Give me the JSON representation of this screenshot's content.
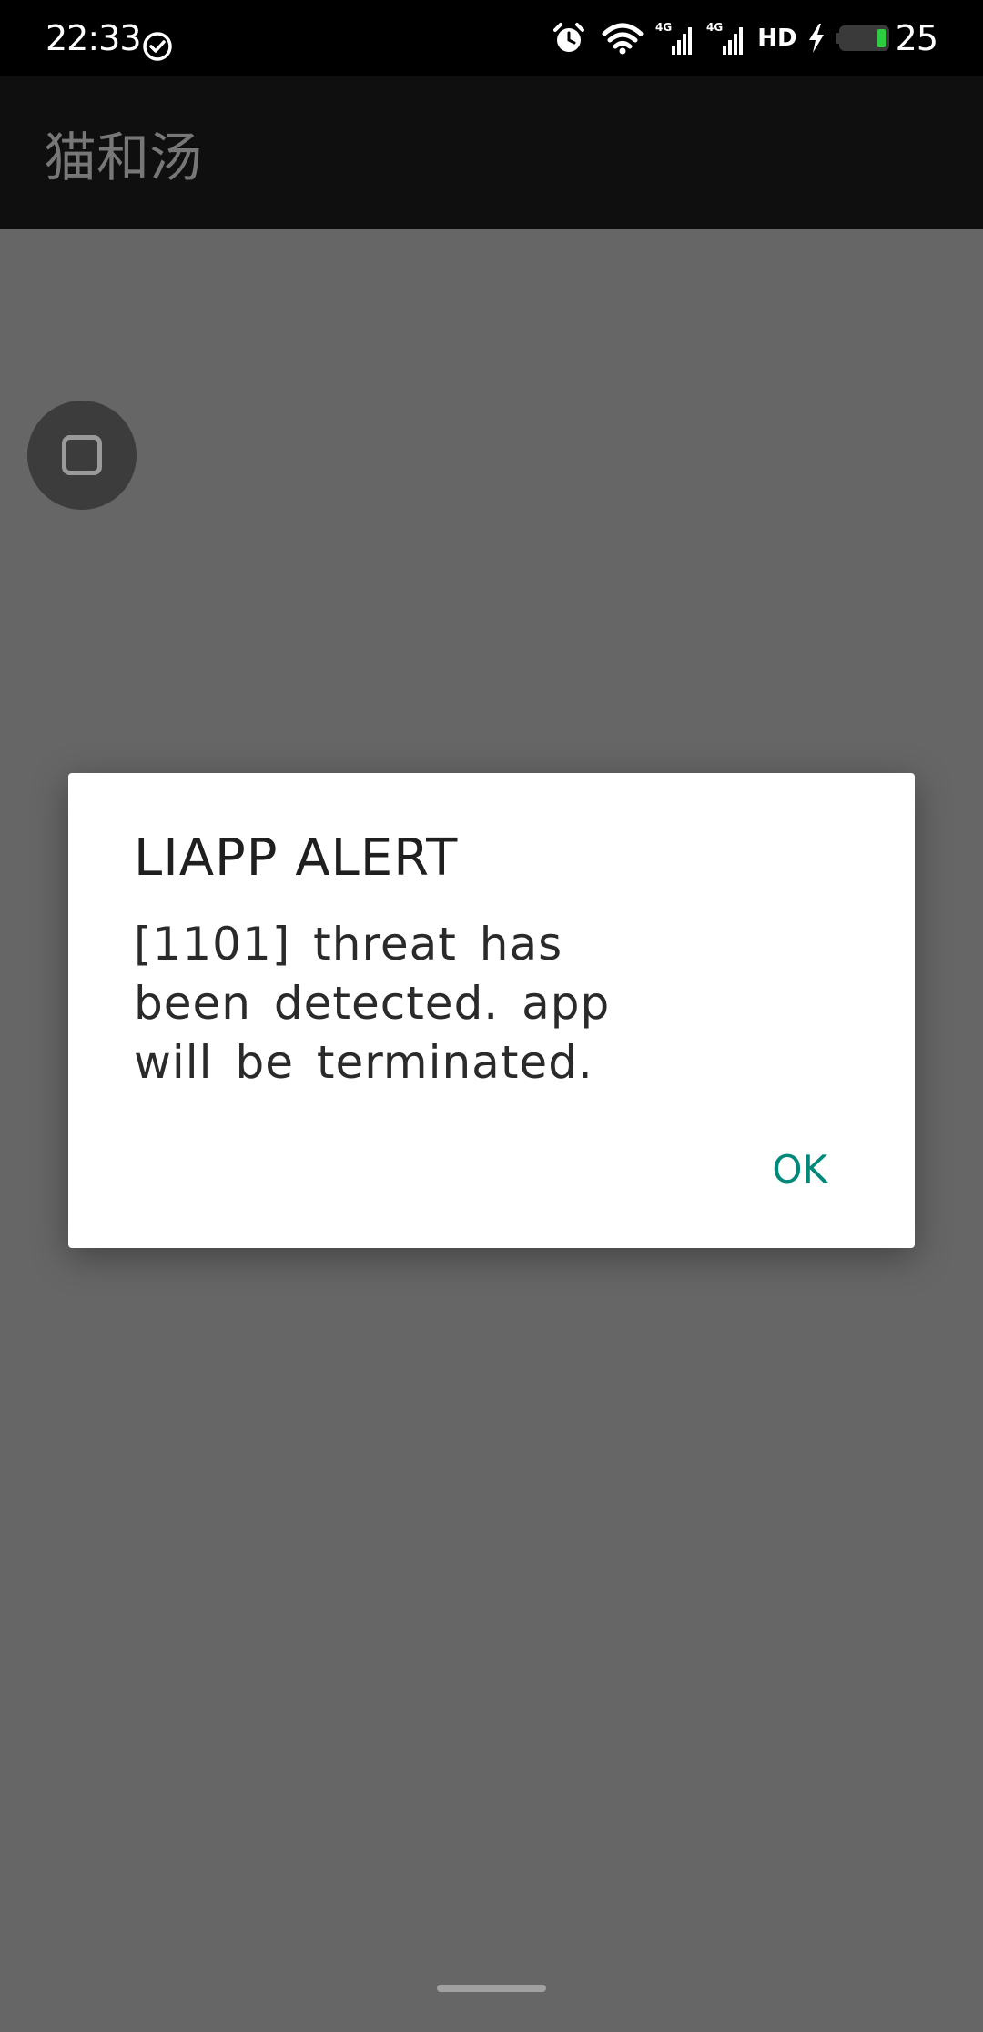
{
  "status_bar": {
    "time": "22:33",
    "icons": [
      "check-circle-icon",
      "alarm-icon",
      "wifi-icon",
      "signal-4g-icon",
      "signal-4g-icon",
      "hd-icon",
      "charging-bolt-icon",
      "battery-icon"
    ],
    "signal_1_label": "4G",
    "signal_2_label": "4G",
    "hd_label": "HD",
    "battery_level": "25",
    "battery_color": "#2ecc40"
  },
  "app_bar": {
    "title": "猫和汤"
  },
  "floating_button": {
    "icon": "square-icon"
  },
  "dialog": {
    "title": "LIAPP ALERT",
    "message": "[1101] threat has been detected. app will be terminated.",
    "ok_label": "OK",
    "ok_color": "#00897b"
  },
  "colors": {
    "scrim": "#666666",
    "status_bar": "#000000",
    "app_bar": "#0f0f0f",
    "dialog_bg": "#ffffff"
  }
}
